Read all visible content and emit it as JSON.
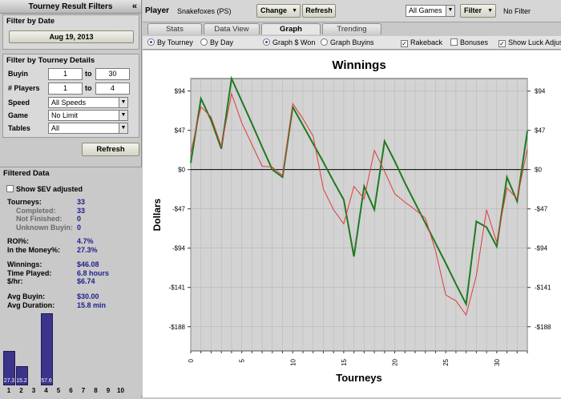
{
  "sidebar": {
    "title": "Tourney Result Filters",
    "collapse": "«",
    "filter_date": {
      "title": "Filter by Date",
      "date": "Aug 19, 2013"
    },
    "filter_details": {
      "title": "Filter by Tourney Details",
      "buyin": {
        "label": "Buyin",
        "from": "1",
        "to_label": "to",
        "to": "30"
      },
      "players": {
        "label": "# Players",
        "from": "1",
        "to_label": "to",
        "to": "4"
      },
      "speed": {
        "label": "Speed",
        "value": "All Speeds"
      },
      "game": {
        "label": "Game",
        "value": "No Limit"
      },
      "tables": {
        "label": "Tables",
        "value": "All"
      }
    },
    "refresh": "Refresh",
    "filtered": {
      "title": "Filtered Data",
      "show_ev": "Show $EV adjusted",
      "stats": [
        {
          "k": "Tourneys:",
          "v": "33"
        },
        {
          "k": "Completed:",
          "v": "33",
          "sub": true
        },
        {
          "k": "Not Finished:",
          "v": "0",
          "sub": true
        },
        {
          "k": "Unknown Buyin:",
          "v": "0",
          "sub": true
        },
        {
          "k": "ROI%:",
          "v": "4.7%"
        },
        {
          "k": "In the Money%:",
          "v": "27.3%"
        },
        {
          "k": "Winnings:",
          "v": "$46.08"
        },
        {
          "k": "Time Played:",
          "v": "6.8 hours"
        },
        {
          "k": "$/hr:",
          "v": "$6.74"
        },
        {
          "k": "Avg Buyin:",
          "v": "$30.00"
        },
        {
          "k": "Avg Duration:",
          "v": "15.8 min"
        }
      ]
    },
    "histogram": {
      "categories": [
        "1",
        "2",
        "3",
        "4",
        "5",
        "6",
        "7",
        "8",
        "9",
        "10"
      ],
      "values": [
        27.3,
        15.2,
        0,
        57.6,
        0,
        0,
        0,
        0,
        0,
        0
      ],
      "labels": [
        "27.3",
        "15.2",
        "",
        "57.6",
        "",
        "",
        "",
        "",
        "",
        ""
      ],
      "color": "#3a348a"
    }
  },
  "topbar": {
    "player_label": "Player",
    "player_name": "Snakefoxes (PS)",
    "change": "Change",
    "refresh": "Refresh",
    "games": "All Games",
    "filter": "Filter",
    "no_filter": "No Filter"
  },
  "tabs": [
    "Stats",
    "Data View",
    "Graph",
    "Trending"
  ],
  "options": {
    "by_tourney": "By Tourney",
    "by_day": "By Day",
    "graph_won": "Graph $ Won",
    "graph_buyins": "Graph Buyins",
    "rakeback": "Rakeback",
    "bonuses": "Bonuses",
    "luck": "Show Luck Adjus"
  },
  "chart_data": {
    "type": "line",
    "title": "Winnings",
    "xlabel": "Tourneys",
    "ylabel": "Dollars",
    "xlim": [
      0,
      33
    ],
    "ylim": [
      -217,
      109
    ],
    "yticks": [
      94,
      47,
      0,
      -47,
      -94,
      -141,
      -188
    ],
    "ytick_labels": [
      "$94",
      "$47",
      "$0",
      "-$47",
      "-$94",
      "-$141",
      "-$188"
    ],
    "xticks": [
      0,
      5,
      10,
      15,
      20,
      25,
      30
    ],
    "grid": true,
    "series": [
      {
        "color": "#1f7a1f",
        "x": [
          0,
          1,
          2,
          3,
          4,
          5,
          6,
          7,
          8,
          9,
          10,
          11,
          12,
          13,
          14,
          15,
          16,
          17,
          18,
          19,
          20,
          21,
          22,
          23,
          24,
          25,
          26,
          27,
          28,
          29,
          30,
          31,
          32,
          33
        ],
        "y": [
          8,
          85,
          59,
          25,
          109,
          82,
          55,
          27,
          0,
          -9,
          75,
          53,
          31,
          9,
          -14,
          -36,
          -104,
          -20,
          -48,
          34,
          10,
          -16,
          -40,
          -64,
          -88,
          -112,
          -137,
          -161,
          -62,
          -69,
          -92,
          -9,
          -38,
          46
        ]
      },
      {
        "color": "#e03c3c",
        "x": [
          0,
          1,
          2,
          3,
          4,
          5,
          6,
          7,
          8,
          9,
          10,
          11,
          12,
          13,
          14,
          15,
          16,
          17,
          18,
          19,
          20,
          21,
          22,
          23,
          24,
          25,
          26,
          27,
          28,
          29,
          30,
          31,
          32,
          33
        ],
        "y": [
          20,
          75,
          63,
          28,
          91,
          56,
          30,
          4,
          3,
          -7,
          79,
          61,
          40,
          -23,
          -48,
          -65,
          -20,
          -35,
          23,
          -2,
          -29,
          -39,
          -48,
          -58,
          -97,
          -150,
          -157,
          -174,
          -127,
          -48,
          -87,
          -22,
          -35,
          25
        ]
      }
    ]
  }
}
